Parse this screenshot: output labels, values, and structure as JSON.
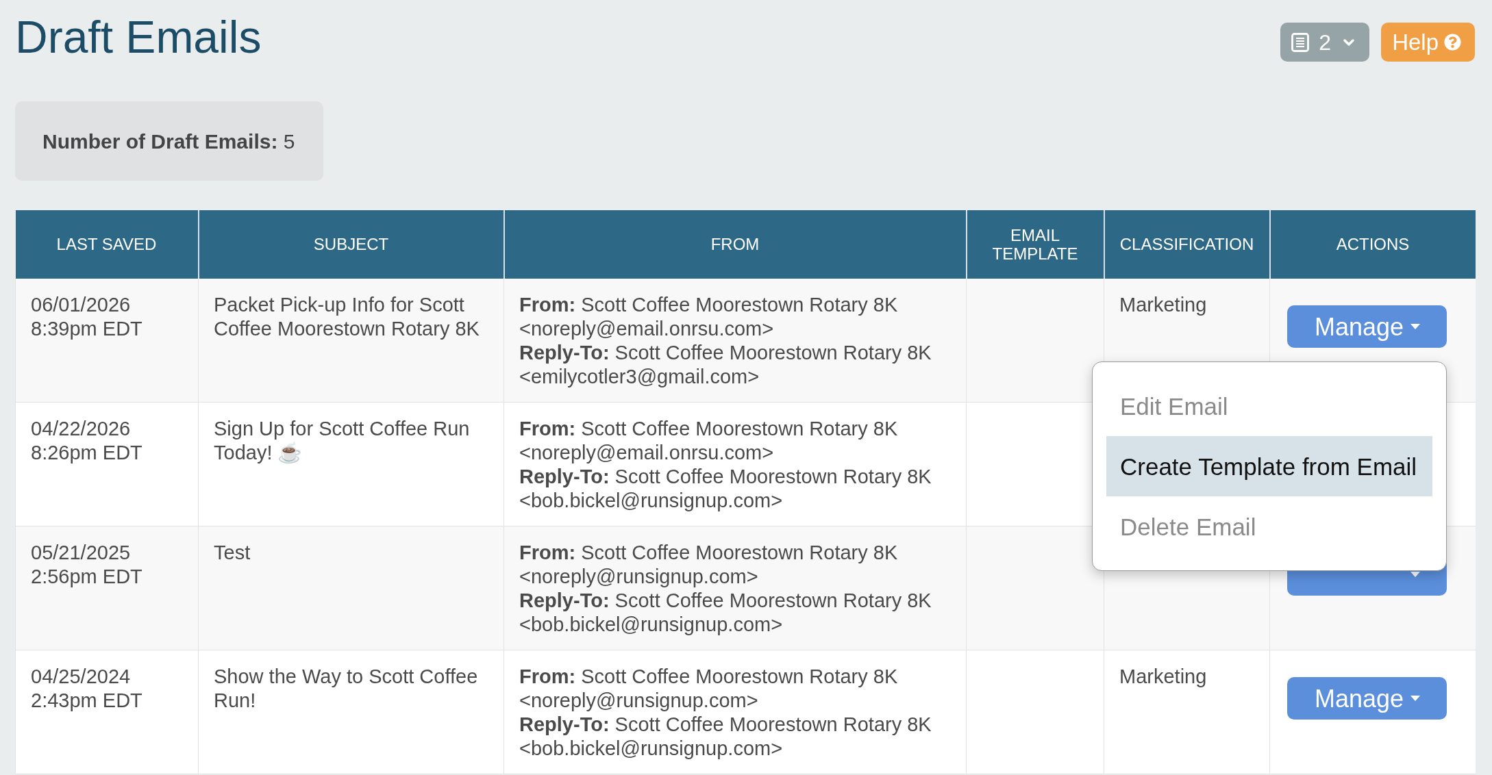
{
  "page": {
    "title": "Draft Emails"
  },
  "toolbar": {
    "pages_button": {
      "label": "2"
    },
    "help_button": {
      "label": "Help"
    }
  },
  "summary": {
    "text": "**Number of Draft Emails:** 5"
  },
  "table": {
    "columns": [
      "LAST SAVED",
      "SUBJECT",
      "FROM",
      "EMAIL TEMPLATE",
      "CLASSIFICATION",
      "ACTIONS"
    ],
    "rows": [
      {
        "date": "06/01/2026",
        "time": "8:39pm EDT",
        "subject": "Packet Pick-up Info for Scott Coffee Moorestown Rotary 8K",
        "from": "**From:** Scott Coffee Moorestown Rotary 8K <noreply@email.onrsu.com>",
        "reply_to": "**Reply-To:** Scott Coffee Moorestown Rotary 8K <emilycotler3@gmail.com>",
        "classification": "Marketing",
        "action": {
          "kind": "dropdown_button",
          "label": "Manage",
          "menu": {
            "items": [
              {
                "label": "Edit Email",
                "selected": false
              },
              {
                "label": "Create Template from Email",
                "selected": true
              },
              {
                "label": "Delete Email",
                "selected": false
              }
            ]
          }
        }
      },
      {
        "date": "04/22/2026",
        "time": "8:26pm EDT",
        "subject": "Sign Up for Scott Coffee Run Today! ☕",
        "from": "**From:** Scott Coffee Moorestown Rotary 8K <noreply@email.onrsu.com>",
        "reply_to": "**Reply-To:** Scott Coffee Moorestown Rotary 8K <bob.bickel@runsignup.com>"
      },
      {
        "date": "05/21/2025",
        "time": "2:56pm EDT",
        "subject": "Test",
        "from": "**From:** Scott Coffee Moorestown Rotary 8K <noreply@runsignup.com>",
        "reply_to": "**Reply-To:** Scott Coffee Moorestown Rotary 8K <bob.bickel@runsignup.com>",
        "action": {
          "kind": "dropdown_button"
        }
      },
      {
        "date": "04/25/2024",
        "time": "2:43pm EDT",
        "subject": "Show the Way to Scott Coffee Run!",
        "from": "**From:** Scott Coffee Moorestown Rotary 8K <noreply@runsignup.com>",
        "reply_to": "**Reply-To:** Scott Coffee Moorestown Rotary 8K <bob.bickel@runsignup.com>",
        "classification": "Marketing",
        "action": {
          "kind": "dropdown_button",
          "label": "Manage"
        }
      }
    ]
  }
}
